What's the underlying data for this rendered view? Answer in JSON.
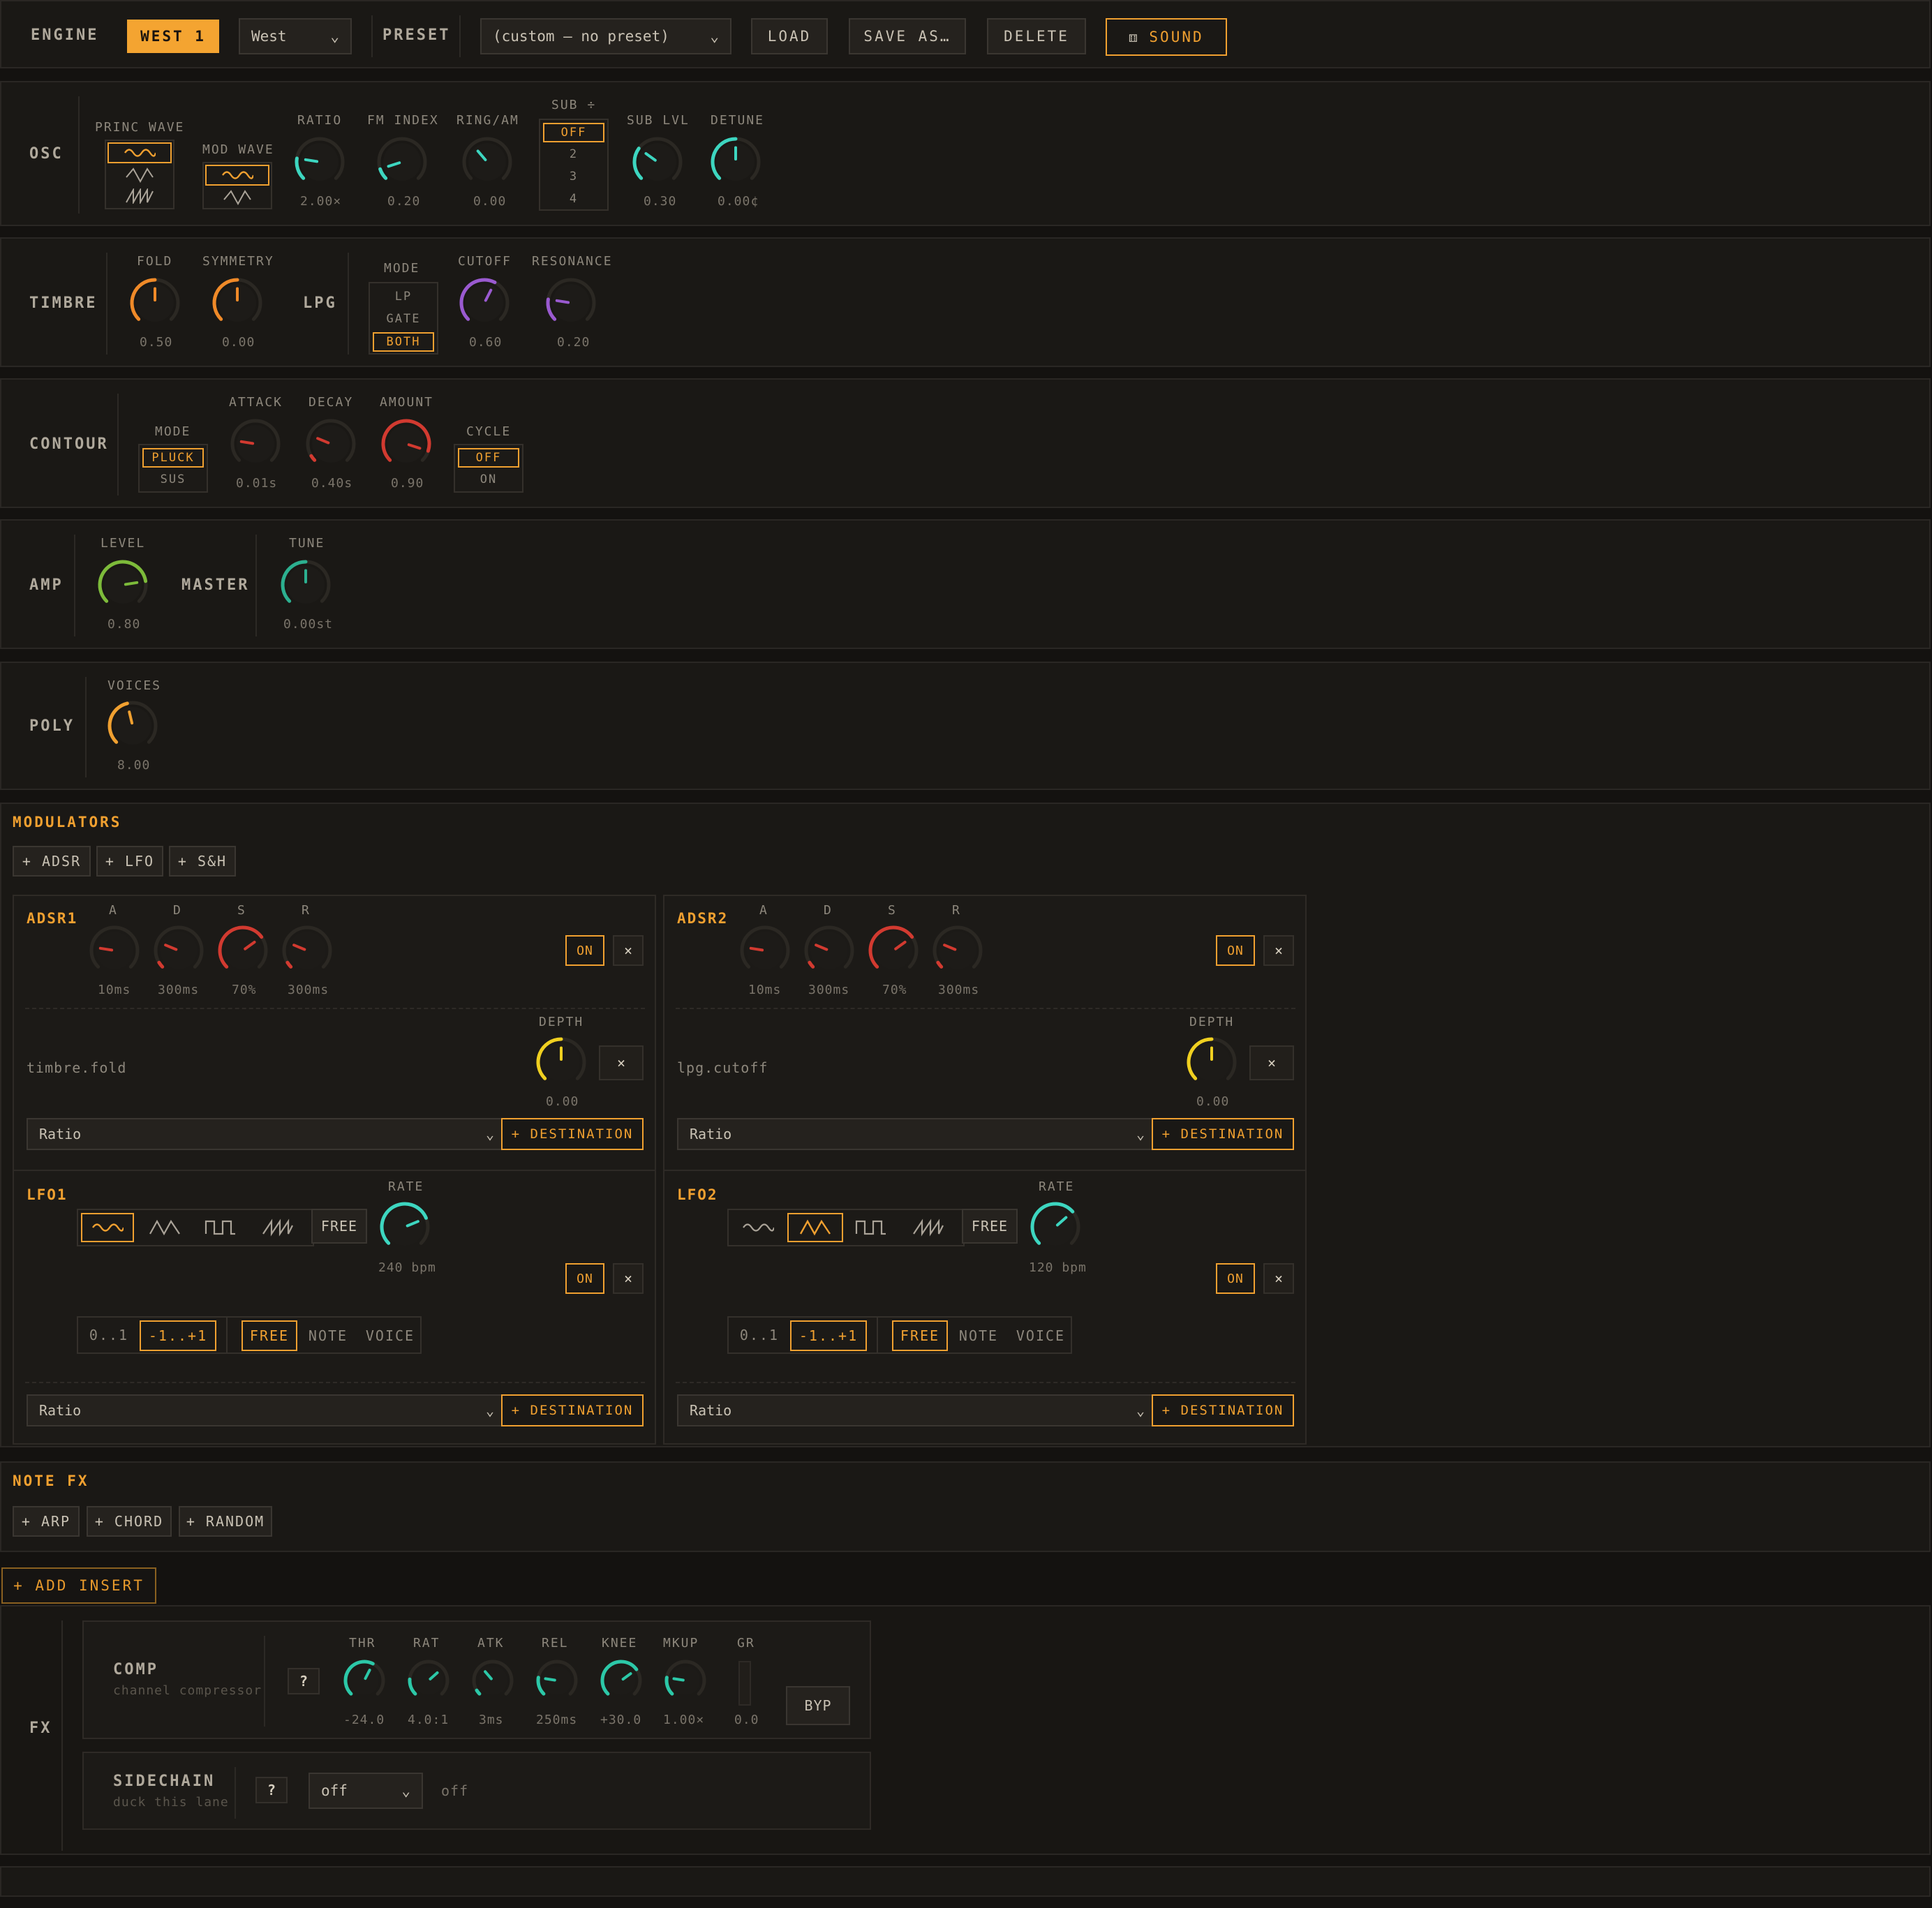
{
  "header": {
    "engine_label": "ENGINE",
    "engine_badge": "WEST 1",
    "engine_select": "West",
    "preset_label": "PRESET",
    "preset_select": "(custom — no preset)",
    "load": "LOAD",
    "save_as": "SAVE AS…",
    "delete": "DELETE",
    "sound": "SOUND"
  },
  "osc": {
    "label": "OSC",
    "princ_wave_label": "PRINC WAVE",
    "mod_wave_label": "MOD WAVE",
    "ratio": {
      "label": "RATIO",
      "value": "2.00×"
    },
    "fm_index": {
      "label": "FM INDEX",
      "value": "0.20"
    },
    "ring_am": {
      "label": "RING/AM",
      "value": "0.00"
    },
    "sub": {
      "label": "SUB ÷",
      "options": [
        "OFF",
        "2",
        "3",
        "4"
      ],
      "selected": "OFF"
    },
    "sub_lvl": {
      "label": "SUB LVL",
      "value": "0.30"
    },
    "detune": {
      "label": "DETUNE",
      "value": "0.00¢"
    }
  },
  "timbre": {
    "label": "TIMBRE",
    "fold": {
      "label": "FOLD",
      "value": "0.50"
    },
    "symmetry": {
      "label": "SYMMETRY",
      "value": "0.00"
    },
    "lpg_label": "LPG",
    "mode_label": "MODE",
    "mode_options": [
      "LP",
      "GATE",
      "BOTH"
    ],
    "mode_selected": "BOTH",
    "cutoff": {
      "label": "CUTOFF",
      "value": "0.60"
    },
    "resonance": {
      "label": "RESONANCE",
      "value": "0.20"
    }
  },
  "contour": {
    "label": "CONTOUR",
    "mode_label": "MODE",
    "mode_options": [
      "PLUCK",
      "SUS"
    ],
    "attack": {
      "label": "ATTACK",
      "value": "0.01s"
    },
    "decay": {
      "label": "DECAY",
      "value": "0.40s"
    },
    "amount": {
      "label": "AMOUNT",
      "value": "0.90"
    },
    "cycle_label": "CYCLE",
    "cycle_options": [
      "OFF",
      "ON"
    ]
  },
  "amp": {
    "label": "AMP",
    "level": {
      "label": "LEVEL",
      "value": "0.80"
    },
    "master_label": "MASTER",
    "tune": {
      "label": "TUNE",
      "value": "0.00st"
    }
  },
  "poly": {
    "label": "POLY",
    "voices": {
      "label": "VOICES",
      "value": "8.00"
    }
  },
  "modulators": {
    "title": "MODULATORS",
    "add_buttons": [
      "+ ADSR",
      "+ LFO",
      "+ S&H"
    ],
    "adsr": [
      {
        "title": "ADSR1",
        "knobs": [
          {
            "label": "A",
            "value": "10ms"
          },
          {
            "label": "D",
            "value": "300ms"
          },
          {
            "label": "S",
            "value": "70%"
          },
          {
            "label": "R",
            "value": "300ms"
          }
        ],
        "on": "ON",
        "close": "×",
        "target": "timbre.fold",
        "depth_label": "DEPTH",
        "depth_value": "0.00",
        "target_close": "×",
        "dest_select": "Ratio",
        "dest_button": "+ DESTINATION"
      },
      {
        "title": "ADSR2",
        "knobs": [
          {
            "label": "A",
            "value": "10ms"
          },
          {
            "label": "D",
            "value": "300ms"
          },
          {
            "label": "S",
            "value": "70%"
          },
          {
            "label": "R",
            "value": "300ms"
          }
        ],
        "on": "ON",
        "close": "×",
        "target": "lpg.cutoff",
        "depth_label": "DEPTH",
        "depth_value": "0.00",
        "target_close": "×",
        "dest_select": "Ratio",
        "dest_button": "+ DESTINATION"
      }
    ],
    "lfo": [
      {
        "title": "LFO1",
        "free": "FREE",
        "rate_label": "RATE",
        "rate_value": "240 bpm",
        "on": "ON",
        "close": "×",
        "range": [
          "0..1",
          "-1..+1"
        ],
        "trig": [
          "FREE",
          "NOTE",
          "VOICE"
        ],
        "dest_select": "Ratio",
        "dest_button": "+ DESTINATION"
      },
      {
        "title": "LFO2",
        "free": "FREE",
        "rate_label": "RATE",
        "rate_value": "120 bpm",
        "on": "ON",
        "close": "×",
        "range": [
          "0..1",
          "-1..+1"
        ],
        "trig": [
          "FREE",
          "NOTE",
          "VOICE"
        ],
        "dest_select": "Ratio",
        "dest_button": "+ DESTINATION"
      }
    ]
  },
  "note_fx": {
    "title": "NOTE FX",
    "buttons": [
      "+ ARP",
      "+ CHORD",
      "+ RANDOM"
    ]
  },
  "add_insert": "+ ADD INSERT",
  "fx": {
    "label": "FX",
    "comp": {
      "title": "COMP",
      "subtitle": "channel compressor",
      "help": "?",
      "knobs": [
        {
          "label": "THR",
          "value": "-24.0"
        },
        {
          "label": "RAT",
          "value": "4.0:1"
        },
        {
          "label": "ATK",
          "value": "3ms"
        },
        {
          "label": "REL",
          "value": "250ms"
        },
        {
          "label": "KNEE",
          "value": "+30.0"
        },
        {
          "label": "MKUP",
          "value": "1.00×"
        }
      ],
      "gr_label": "GR",
      "gr_value": "0.0",
      "byp": "BYP"
    },
    "sidechain": {
      "title": "SIDECHAIN",
      "subtitle": "duck this lane",
      "help": "?",
      "select": "off",
      "status": "off"
    }
  },
  "colors": {
    "accent": "#f0a030",
    "teal": "#3dd6c0",
    "orange": "#f08a28",
    "purple": "#9a5ad0",
    "red": "#d23a30",
    "green": "#7dbb3a",
    "yellow": "#f0d020"
  }
}
